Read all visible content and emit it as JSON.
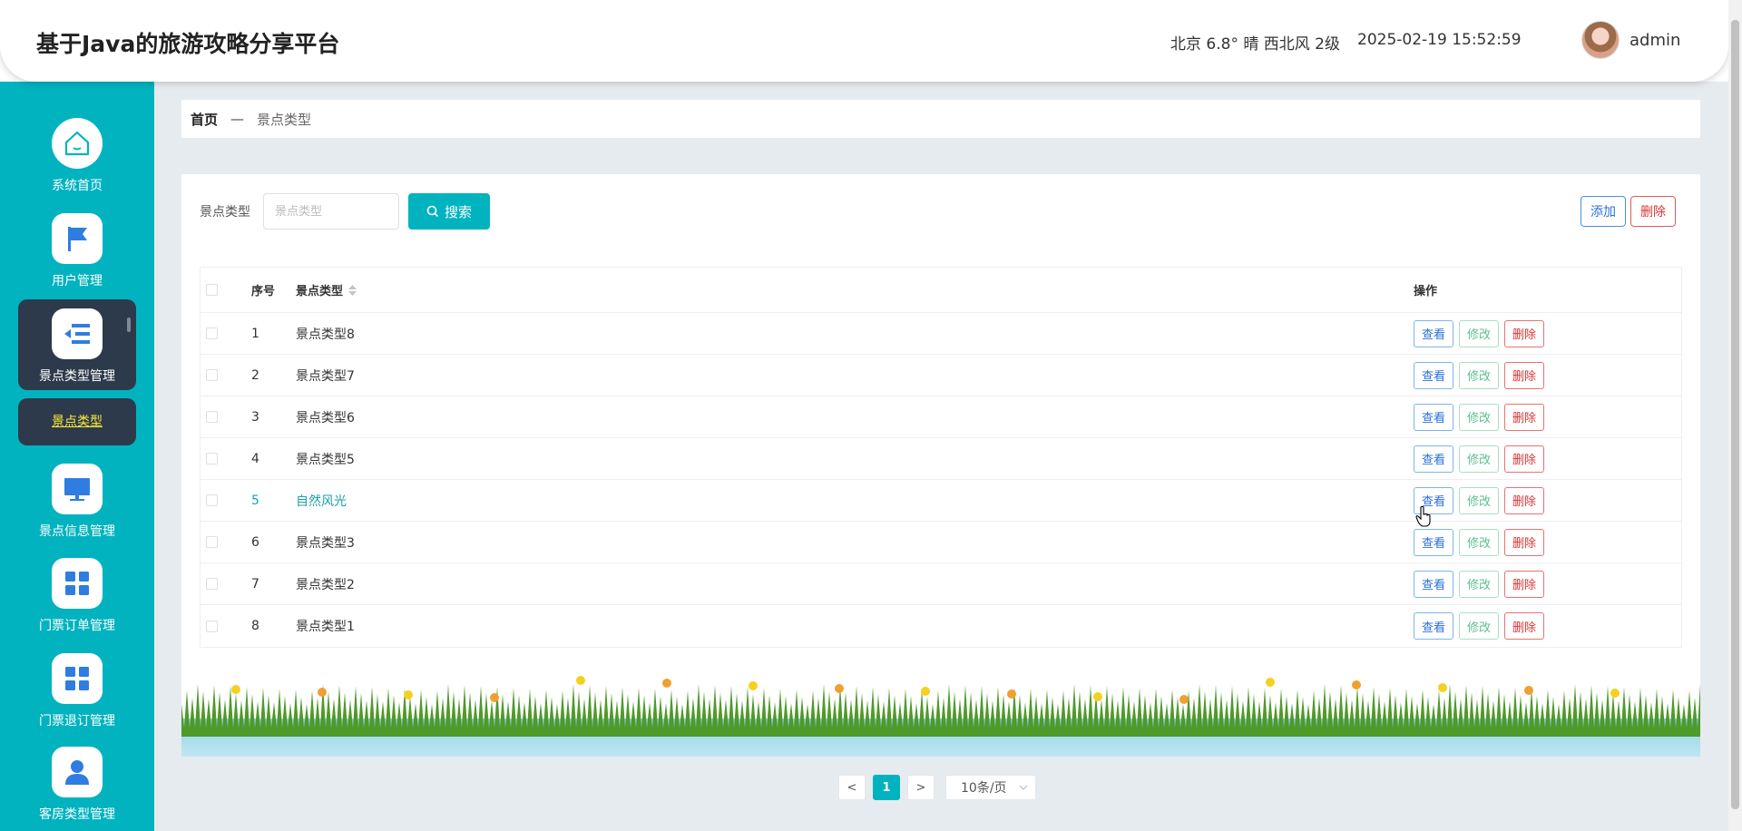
{
  "header": {
    "title": "基于Java的旅游攻略分享平台",
    "weather": "北京  6.8°  晴  西北风  2级",
    "datetime": "2025-02-19 15:52:59",
    "username": "admin"
  },
  "sidebar": {
    "items": [
      {
        "label": "系统首页",
        "icon": "home-icon"
      },
      {
        "label": "用户管理",
        "icon": "flag-icon"
      },
      {
        "label": "景点类型管理",
        "icon": "list-indent-icon"
      },
      {
        "label": "景点信息管理",
        "icon": "monitor-icon"
      },
      {
        "label": "门票订单管理",
        "icon": "grid-icon"
      },
      {
        "label": "门票退订管理",
        "icon": "grid-icon"
      },
      {
        "label": "客房类型管理",
        "icon": "user-icon"
      }
    ],
    "active_sub": "景点类型"
  },
  "breadcrumb": {
    "home": "首页",
    "separator": "—",
    "current": "景点类型"
  },
  "search": {
    "label": "景点类型",
    "placeholder": "景点类型",
    "button": "搜索"
  },
  "actions": {
    "add": "添加",
    "delete": "删除"
  },
  "table": {
    "columns": {
      "no": "序号",
      "type": "景点类型",
      "ops": "操作"
    },
    "rows": [
      {
        "no": "1",
        "type": "景点类型8"
      },
      {
        "no": "2",
        "type": "景点类型7"
      },
      {
        "no": "3",
        "type": "景点类型6"
      },
      {
        "no": "4",
        "type": "景点类型5"
      },
      {
        "no": "5",
        "type": "自然风光"
      },
      {
        "no": "6",
        "type": "景点类型3"
      },
      {
        "no": "7",
        "type": "景点类型2"
      },
      {
        "no": "8",
        "type": "景点类型1"
      }
    ],
    "ops": {
      "view": "查看",
      "edit": "修改",
      "delete": "删除"
    }
  },
  "pagination": {
    "prev": "<",
    "current": "1",
    "next": ">",
    "page_size": "10条/页"
  },
  "colors": {
    "accent": "#00b3bf",
    "sidebar_active": "#2d3a4b",
    "sub_text": "#ffeb3b"
  }
}
